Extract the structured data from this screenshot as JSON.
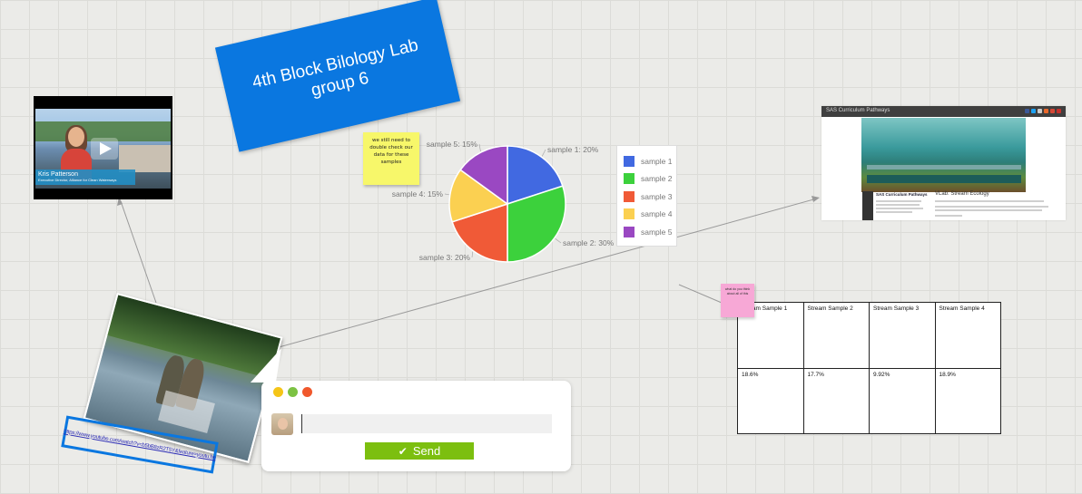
{
  "board": {
    "title_card": {
      "text": "4th Block Bilology Lab\ngroup 6",
      "color": "#0a77e0"
    }
  },
  "video": {
    "caption_name": "Kris Patterson",
    "caption_role": "Executive Director, Alliance for Clean Waterways"
  },
  "sticky_note": {
    "text": "we still need to double check our data for these samples",
    "color": "#f7f76a"
  },
  "chart_data": {
    "type": "pie",
    "categories": [
      "sample 1",
      "sample 2",
      "sample 3",
      "sample 4",
      "sample 5"
    ],
    "values": [
      20,
      30,
      20,
      15,
      15
    ],
    "slice_labels": [
      "sample 1: 20%",
      "sample 2: 30%",
      "sample 3: 20%",
      "sample 4: 15%",
      "sample 5: 15%"
    ],
    "colors": [
      "#4169e1",
      "#3cd13c",
      "#f05a37",
      "#fbd051",
      "#9a48c2"
    ],
    "legend": {
      "position": "right",
      "items": [
        "sample 1",
        "sample 2",
        "sample 3",
        "sample 4",
        "sample 5"
      ]
    }
  },
  "sas_page": {
    "brand": "SAS Curriculum Pathways",
    "heading": "VLab: Stream Ecology",
    "publisher": "SAS Curriculum Pathways"
  },
  "photo": {
    "icon": "stream-sampling-photo"
  },
  "link": {
    "text": "https://www.youtube.com/watch?v=b5bB8zR2T5Y&feature=youtu.be"
  },
  "chat": {
    "input_value": "",
    "input_placeholder": "",
    "send_label": "Send",
    "send_color": "#7cbf0f",
    "dots": [
      "#f5c518",
      "#7cc243",
      "#f0582c"
    ]
  },
  "pink_note": {
    "text": "what do you think about all of this",
    "color": "#f7a8d6"
  },
  "table": {
    "headers": [
      "Stream Sample 1",
      "Stream Sample 2",
      "Stream Sample 3",
      "Stream Sample 4"
    ],
    "values": [
      "18.6%",
      "17.7%",
      "9.92%",
      "18.9%"
    ]
  }
}
